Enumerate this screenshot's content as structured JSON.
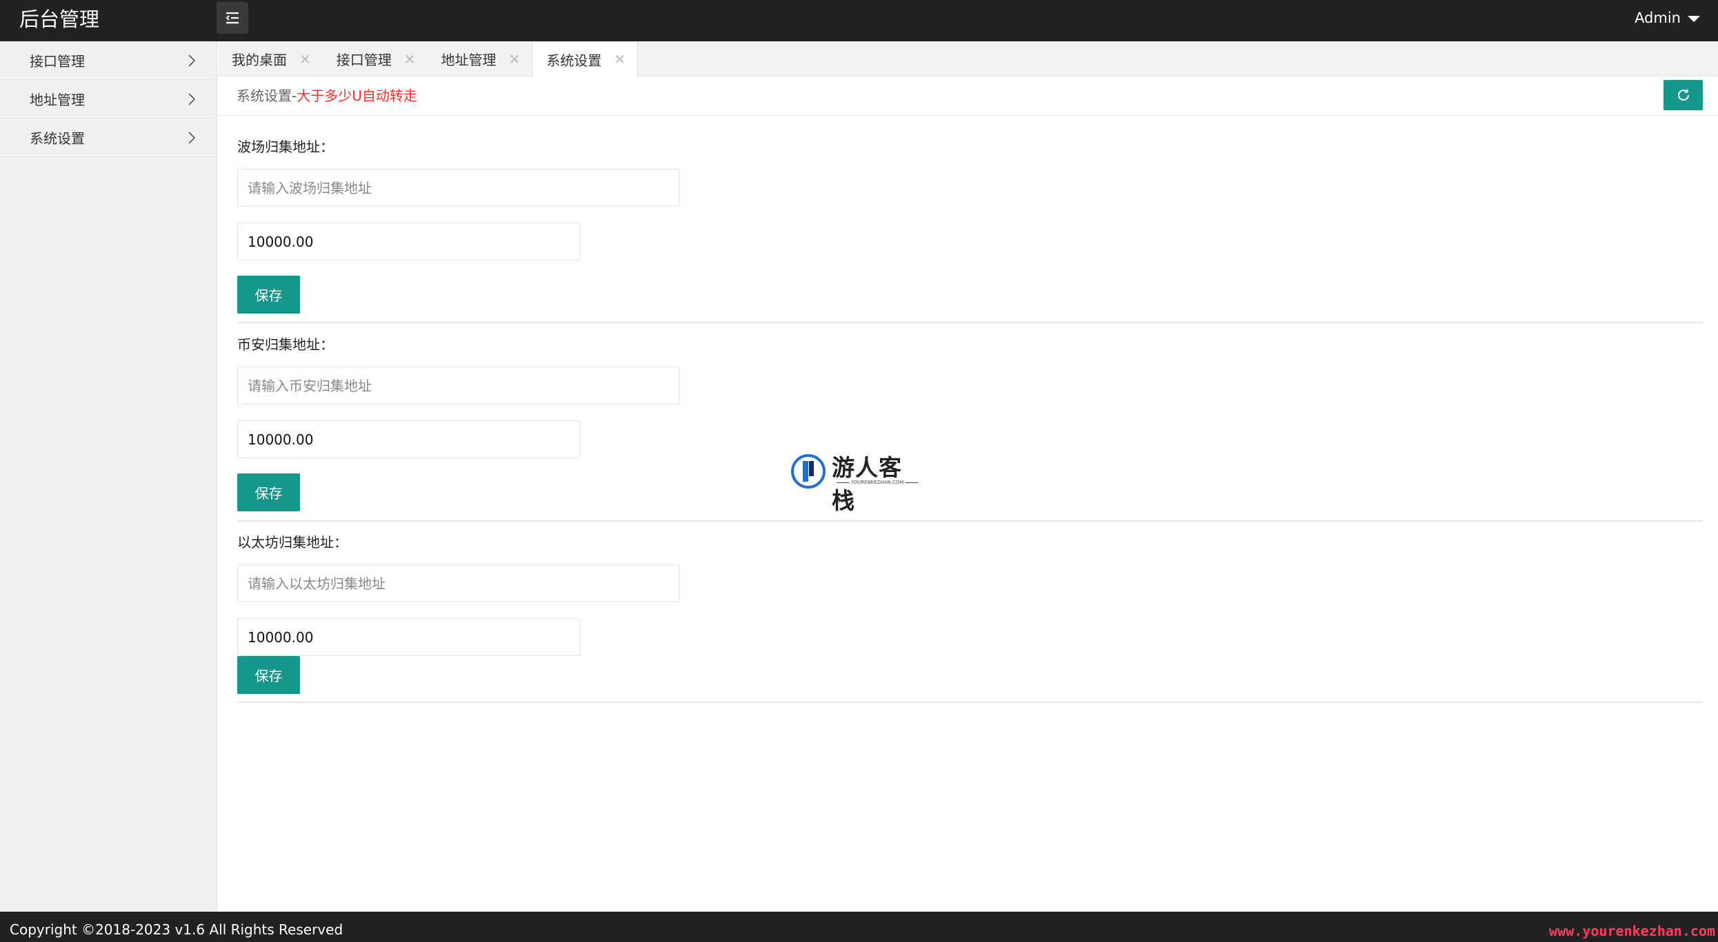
{
  "header": {
    "brand": "后台管理",
    "user": "Admin"
  },
  "sidebar": {
    "items": [
      {
        "label": "接口管理"
      },
      {
        "label": "地址管理"
      },
      {
        "label": "系统设置"
      }
    ]
  },
  "tabs": [
    {
      "label": "我的桌面",
      "close": "✕"
    },
    {
      "label": "接口管理",
      "close": "✕"
    },
    {
      "label": "地址管理",
      "close": "✕"
    },
    {
      "label": "系统设置",
      "close": "✕",
      "active": true
    }
  ],
  "page": {
    "crumb_prefix": "系统设置-",
    "crumb_highlight": "大于多少U自动转走"
  },
  "sections": [
    {
      "label": "波场归集地址：",
      "address_placeholder": "请输入波场归集地址",
      "address_value": "",
      "amount": "10000.00",
      "save": "保存"
    },
    {
      "label": "币安归集地址：",
      "address_placeholder": "请输入币安归集地址",
      "address_value": "",
      "amount": "10000.00",
      "save": "保存"
    },
    {
      "label": "以太坊归集地址：",
      "address_placeholder": "请输入以太坊归集地址",
      "address_value": "",
      "amount": "10000.00",
      "save": "保存"
    }
  ],
  "watermark": {
    "name": "游人客栈",
    "sub": "YOURENKEZHAN.COM"
  },
  "footer": {
    "copyright": "Copyright ©2018-2023 v1.6 All Rights Reserved",
    "site": "www.yourenkezhan.com"
  },
  "colors": {
    "topbar": "#222222",
    "accent": "#16978b",
    "highlight": "#ff2a2a",
    "site_url": "#ff3b5c"
  },
  "icons": {
    "menu_toggle": "menu-collapse-icon",
    "user_dropdown": "caret-down-icon",
    "sidebar_chevron": "chevron-right-icon",
    "tab_close": "close-icon",
    "refresh": "refresh-icon"
  }
}
